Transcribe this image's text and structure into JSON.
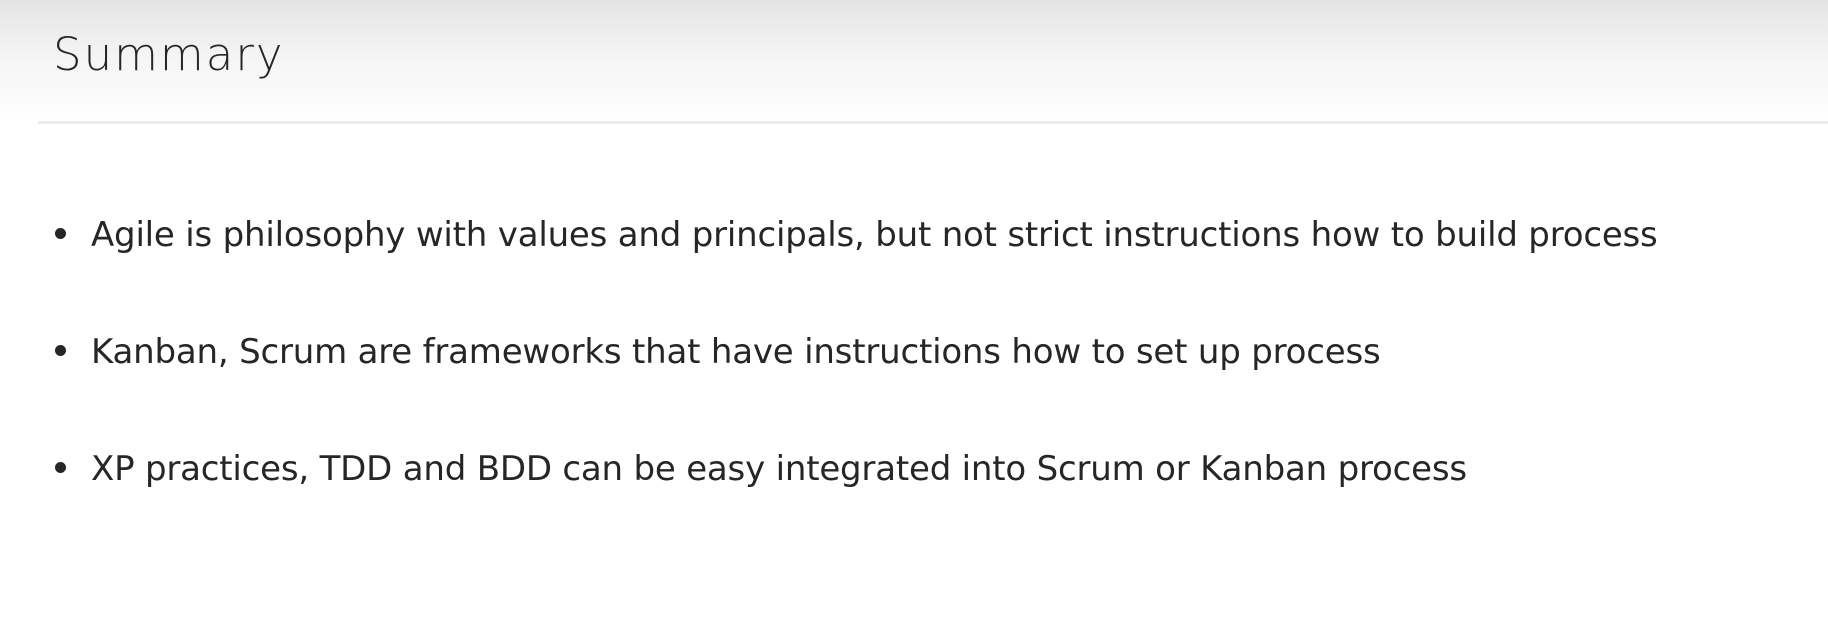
{
  "slide": {
    "title": "Summary",
    "bullets": [
      {
        "text": "Agile is philosophy with values and principals, but not strict instructions how to build process"
      },
      {
        "text": "Kanban, Scrum are frameworks that have instructions how to set up process"
      },
      {
        "text": "XP practices, TDD and BDD can be easy integrated into Scrum or Kanban process"
      }
    ]
  },
  "colors": {
    "text": "#262626",
    "background": "#ffffff",
    "rule": "#ebebeb"
  }
}
